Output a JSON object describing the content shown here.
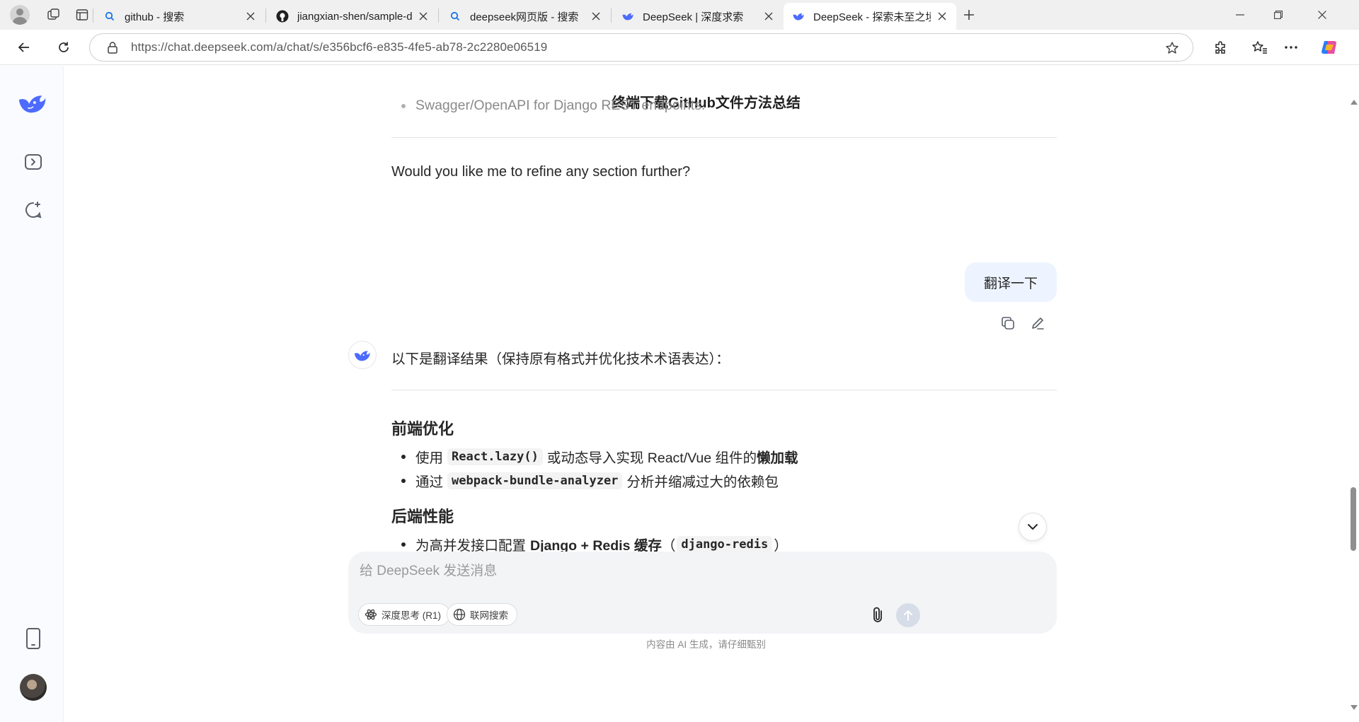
{
  "browser": {
    "tabs": [
      {
        "title": "github - 搜索",
        "favicon": "search-icon"
      },
      {
        "title": "jiangxian-shen/sample-django-pr",
        "favicon": "github-icon"
      },
      {
        "title": "deepseek网页版 - 搜索",
        "favicon": "search-icon"
      },
      {
        "title": "DeepSeek | 深度求索",
        "favicon": "deepseek-icon"
      },
      {
        "title": "DeepSeek - 探索未至之境",
        "favicon": "deepseek-icon",
        "active": true
      }
    ],
    "url": "https://chat.deepseek.com/a/chat/s/e356bcf6-e835-4fe5-ab78-2c2280e06519",
    "accent": "#4d6bfe"
  },
  "chat": {
    "title": "终端下载GitHub文件方法总结",
    "earlier_bullet": "Swagger/OpenAPI for Django REST endpoints.",
    "followup": "Would you like me to refine any section further?",
    "user_message": "翻译一下",
    "ai_intro": "以下是翻译结果（保持原有格式并优化技术术语表达）：",
    "section1": {
      "heading": "前端优化",
      "items": [
        {
          "pre": "使用",
          "code": "React.lazy()",
          "mid": "或动态导入实现 React/Vue 组件的",
          "bold": "懒加载"
        },
        {
          "pre": "通过",
          "code": "webpack-bundle-analyzer",
          "mid": "分析并缩减过大的依赖包"
        }
      ]
    },
    "section2": {
      "heading": "后端性能",
      "items": [
        {
          "pre": "为高并发接口配置",
          "bold": "Django + Redis 缓存",
          "open": "（",
          "code": "django-redis",
          "close": "）"
        }
      ]
    }
  },
  "composer": {
    "placeholder": "给 DeepSeek 发送消息",
    "deep_think_label": "深度思考 (R1)",
    "web_search_label": "联网搜索",
    "disclaimer": "内容由 AI 生成，请仔细甄别"
  }
}
